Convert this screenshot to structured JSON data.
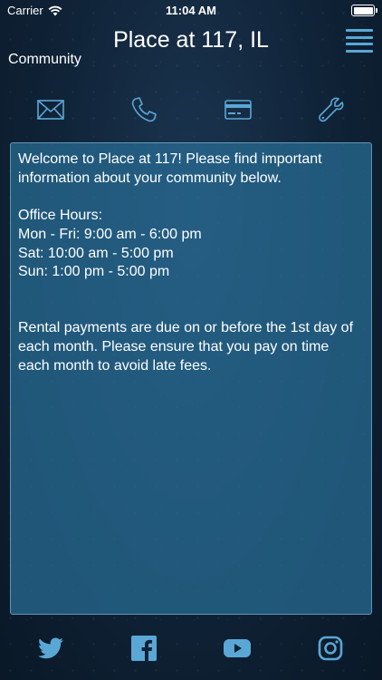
{
  "status": {
    "carrier": "Carrier",
    "time": "11:04 AM"
  },
  "header": {
    "title": "Place at 117, IL",
    "subtitle": "Community"
  },
  "actions": [
    {
      "icon": "mail-icon"
    },
    {
      "icon": "phone-icon"
    },
    {
      "icon": "credit-card-icon"
    },
    {
      "icon": "wrench-icon"
    }
  ],
  "content": {
    "welcome": "Welcome to Place at 117! Please find important information about your community below.",
    "office_hours_heading": "Office Hours:",
    "hours": [
      "Mon - Fri: 9:00 am - 6:00 pm",
      "Sat: 10:00 am - 5:00 pm",
      "Sun: 1:00 pm - 5:00 pm"
    ],
    "rental_notice": "Rental payments are due on or before the 1st day of each month. Please ensure that you pay on time each month to avoid late fees."
  },
  "social": [
    {
      "icon": "twitter-icon"
    },
    {
      "icon": "facebook-icon"
    },
    {
      "icon": "youtube-icon"
    },
    {
      "icon": "instagram-icon"
    }
  ],
  "colors": {
    "accent": "#5aa7d6",
    "card": "#286e96"
  }
}
